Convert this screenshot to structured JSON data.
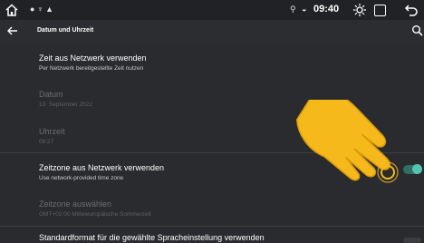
{
  "status_bar": {
    "time": "09:40",
    "icons": [
      "home-icon",
      "notification-icons",
      "location-icon",
      "wifi-icon",
      "brightness-icon",
      "recent-apps-icon",
      "back-icon"
    ]
  },
  "app_bar": {
    "title": "Datum und Uhrzeit"
  },
  "settings": [
    {
      "title": "Zeit aus Netzwerk verwenden",
      "subtitle": "Per Netzwerk bereitgestellte Zeit nutzen",
      "enabled": true
    },
    {
      "title": "Datum",
      "subtitle": "13. September 2022",
      "enabled": false
    },
    {
      "title": "Uhrzeit",
      "subtitle": "09:27",
      "enabled": false
    },
    {
      "title": "Zeitzone aus Netzwerk verwenden",
      "subtitle": "Use network-provided time zone",
      "enabled": true,
      "toggle_on": true
    },
    {
      "title": "Zeitzone auswählen",
      "subtitle": "GMT+02:00 Mitteleuropäische Sommerzeit",
      "enabled": false
    },
    {
      "title": "Standardformat für die gewählte Spracheinstellung verwenden",
      "enabled": true
    }
  ],
  "colors": {
    "background": "#2a2b2e",
    "accent": "#56c2b0",
    "pointer_hand": "#f5b91c"
  }
}
